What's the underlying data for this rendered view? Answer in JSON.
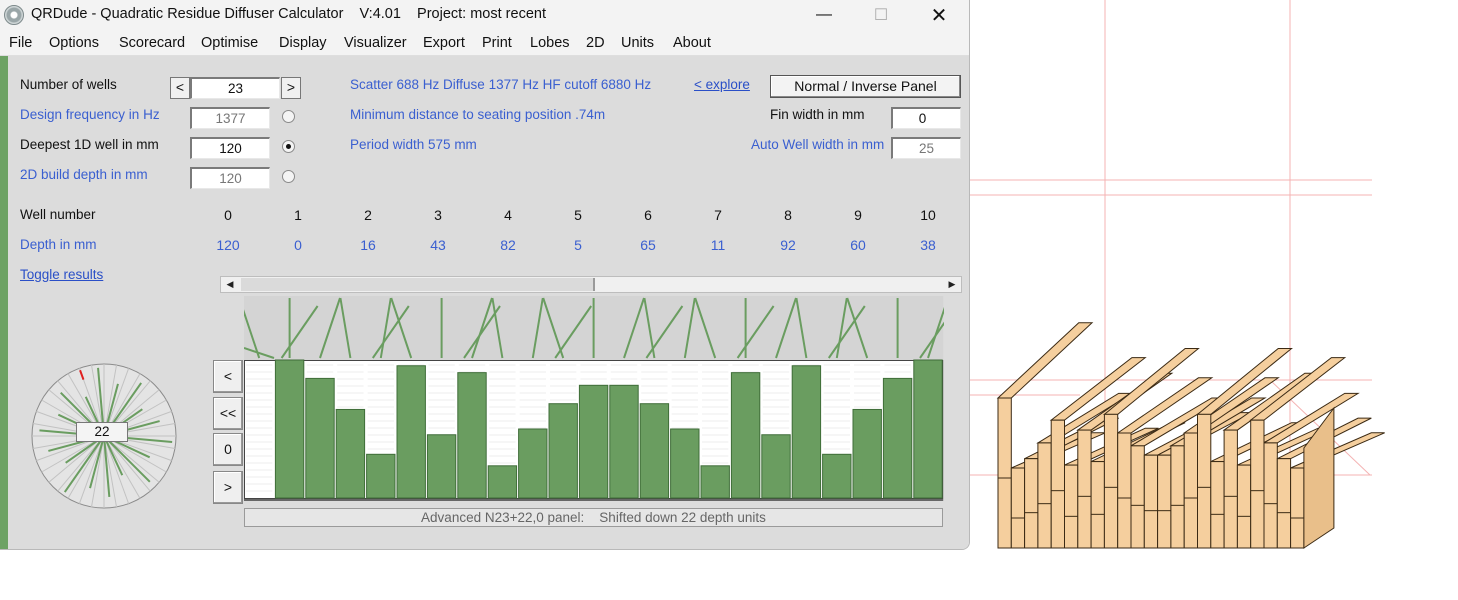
{
  "window": {
    "title": "QRDude - Quadratic Residue Diffuser Calculator    V:4.01    Project: most recent",
    "controls": {
      "minimize": "—",
      "maximize": "☐",
      "close": "✕"
    }
  },
  "menu": [
    "File",
    "Options",
    "Scorecard",
    "Optimise",
    "Display",
    "Visualizer",
    "Export",
    "Print",
    "Lobes",
    "2D",
    "Units",
    "About"
  ],
  "form": {
    "wells_label": "Number of wells",
    "wells_value": "23",
    "wells_dec": "<",
    "wells_inc": ">",
    "design_freq_label": "Design frequency in Hz",
    "design_freq_value": "1377",
    "deepest_label": "Deepest 1D well in mm",
    "deepest_value": "120",
    "build_depth_label": "2D build depth in mm",
    "build_depth_value": "120",
    "selected_radio": "deepest"
  },
  "info": {
    "frequencies": "Scatter 688 Hz   Diffuse 1377 Hz   HF cutoff 6880 Hz",
    "explore_link": "< explore",
    "min_distance": "Minimum distance to seating position  .74m",
    "period_width": "Period width  575 mm",
    "panel_button": "Normal / Inverse Panel",
    "fin_width_label": "Fin width in mm",
    "fin_width_value": "0",
    "auto_well_label": "Auto Well width in mm",
    "auto_well_value": "25"
  },
  "table": {
    "well_number_label": "Well number",
    "depth_label": "Depth in mm",
    "toggle_link": "Toggle results",
    "wells": [
      "0",
      "1",
      "2",
      "3",
      "4",
      "5",
      "6",
      "7",
      "8",
      "9",
      "10"
    ],
    "depths": [
      "120",
      "0",
      "16",
      "43",
      "82",
      "5",
      "65",
      "11",
      "92",
      "60",
      "38"
    ]
  },
  "scrollbar": {
    "left": "◀",
    "right": "▶"
  },
  "panel_depths": [
    120,
    0,
    16,
    43,
    82,
    5,
    65,
    11,
    92,
    60,
    38,
    22,
    22,
    38,
    60,
    92,
    11,
    65,
    5,
    82,
    43,
    16,
    0
  ],
  "nav_buttons": [
    "<",
    "<<",
    "0",
    ">"
  ],
  "polar_readout": "22",
  "status": "Advanced N23+22,0 panel:    Shifted down 22 depth units",
  "colors": {
    "well_fill": "#6a9d60",
    "accent_blue": "#3a5fd0",
    "wood": "#f5cf9e",
    "grid_red": "#f2a0a0"
  },
  "icons": {
    "app": "qrdude-app-icon"
  }
}
